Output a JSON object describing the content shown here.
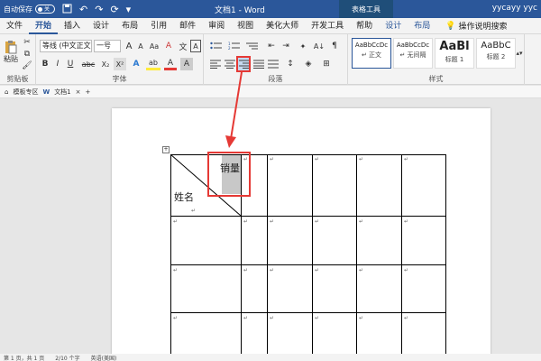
{
  "titlebar": {
    "autosave_label": "自动保存",
    "autosave_state": "关",
    "doc_title": "文档1 - Word",
    "context_tab_group": "表格工具",
    "user": "yycayy yyc",
    "qat_icons": [
      "save-icon",
      "undo-icon",
      "redo-icon",
      "refresh-icon",
      "customize-icon"
    ]
  },
  "tabs": [
    "文件",
    "开始",
    "插入",
    "设计",
    "布局",
    "引用",
    "邮件",
    "审阅",
    "视图",
    "美化大师",
    "开发工具",
    "帮助"
  ],
  "context_tabs": [
    "设计",
    "布局"
  ],
  "search_tab": "操作说明搜索",
  "ribbon": {
    "clipboard": {
      "paste": "粘贴",
      "label": "剪贴板"
    },
    "font": {
      "font_name": "等线 (中文正文",
      "font_size": "一号",
      "label": "字体",
      "grow": "A",
      "shrink": "A",
      "bold": "B",
      "italic": "I",
      "underline": "U",
      "strike": "abc",
      "sub": "X₂",
      "sup": "X²",
      "clear": "A",
      "highlight": "ab",
      "color": "A",
      "char_shade": "A",
      "char_border": "A",
      "pinyin": "文"
    },
    "paragraph": {
      "label": "段落",
      "sort": "A↓",
      "show_marks": "¶"
    },
    "styles": {
      "label": "样式",
      "items": [
        {
          "sample": "AaBbCcDc",
          "name": "↵ 正文"
        },
        {
          "sample": "AaBbCcDc",
          "name": "↵ 无间隔"
        },
        {
          "sample": "AaBl",
          "name": "标题 1"
        },
        {
          "sample": "AaBbC",
          "name": "标题 2"
        }
      ]
    }
  },
  "navbar": {
    "template_tab": "模板专区",
    "doc_tab": "文档1",
    "add": "+"
  },
  "document": {
    "header_top": "销量",
    "header_bottom": "姓名"
  },
  "statusbar": {
    "page": "第 1 页，共 1 页",
    "words": "2/10 个字",
    "lang": "英语(美国)"
  },
  "colors": {
    "title_blue": "#2b579a",
    "highlight_red": "#e53935",
    "selected_cell": "#c8c8c8"
  }
}
